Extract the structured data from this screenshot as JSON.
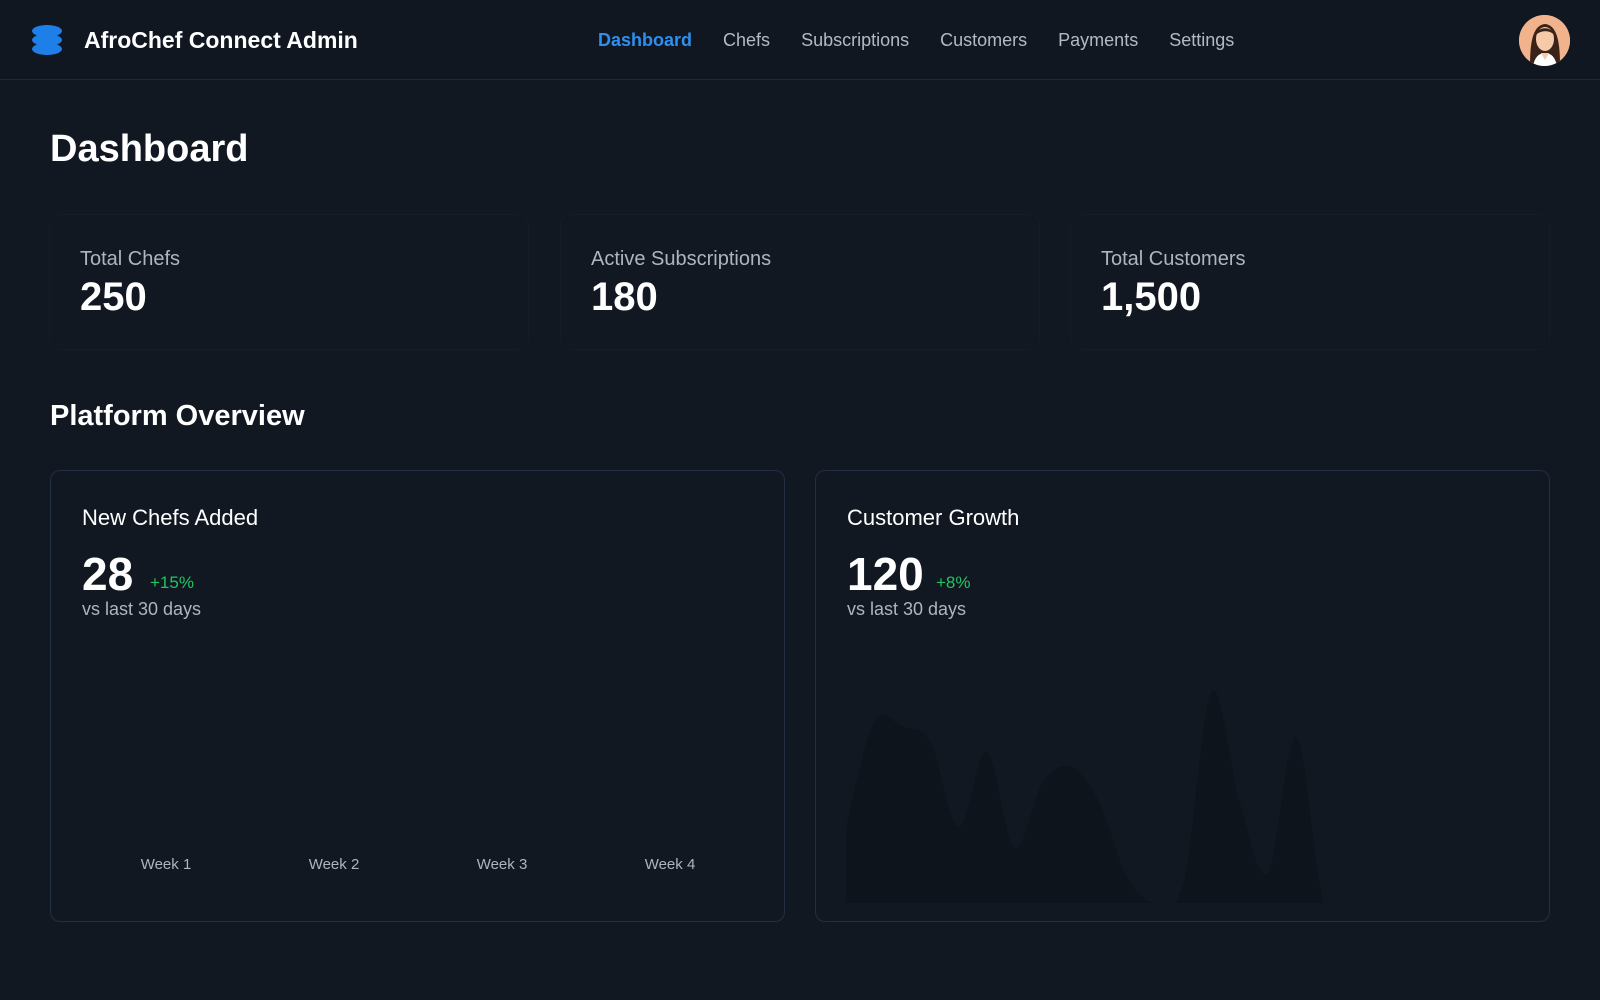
{
  "header": {
    "brand_title": "AfroChef Connect Admin",
    "brand_icon": "stack-icon",
    "accent_color": "#2f8ff0",
    "nav": [
      {
        "label": "Dashboard",
        "active": true
      },
      {
        "label": "Chefs",
        "active": false
      },
      {
        "label": "Subscriptions",
        "active": false
      },
      {
        "label": "Customers",
        "active": false
      },
      {
        "label": "Payments",
        "active": false
      },
      {
        "label": "Settings",
        "active": false
      }
    ]
  },
  "page": {
    "title": "Dashboard"
  },
  "stats": [
    {
      "label": "Total Chefs",
      "value": "250"
    },
    {
      "label": "Active Subscriptions",
      "value": "180"
    },
    {
      "label": "Total Customers",
      "value": "1,500"
    }
  ],
  "overview": {
    "title": "Platform Overview",
    "new_chefs": {
      "title": "New Chefs Added",
      "value": "28",
      "change": "+15%",
      "change_color": "#22c55e",
      "subtext": "vs last 30 days"
    },
    "customer_growth": {
      "title": "Customer Growth",
      "value": "120",
      "change": "+8%",
      "change_color": "#22c55e",
      "subtext": "vs last 30 days"
    }
  },
  "chart_data": [
    {
      "type": "bar",
      "categories": [
        "Week 1",
        "Week 2",
        "Week 3",
        "Week 4"
      ],
      "values": [],
      "xlabel": "",
      "ylabel": ""
    },
    {
      "type": "area",
      "x": [
        0,
        1,
        2,
        3,
        4,
        5,
        6,
        7,
        8,
        9,
        10,
        11,
        12,
        13,
        14,
        15,
        16,
        17,
        18,
        19,
        20,
        21,
        22,
        23,
        24
      ],
      "values": [
        30,
        72,
        70,
        64,
        30,
        60,
        22,
        48,
        54,
        40,
        10,
        0,
        8,
        84,
        40,
        12,
        66,
        0,
        0,
        0,
        0,
        0,
        0,
        0,
        0
      ],
      "fill_color": "#0e141c",
      "xlabel": "",
      "ylabel": ""
    }
  ]
}
